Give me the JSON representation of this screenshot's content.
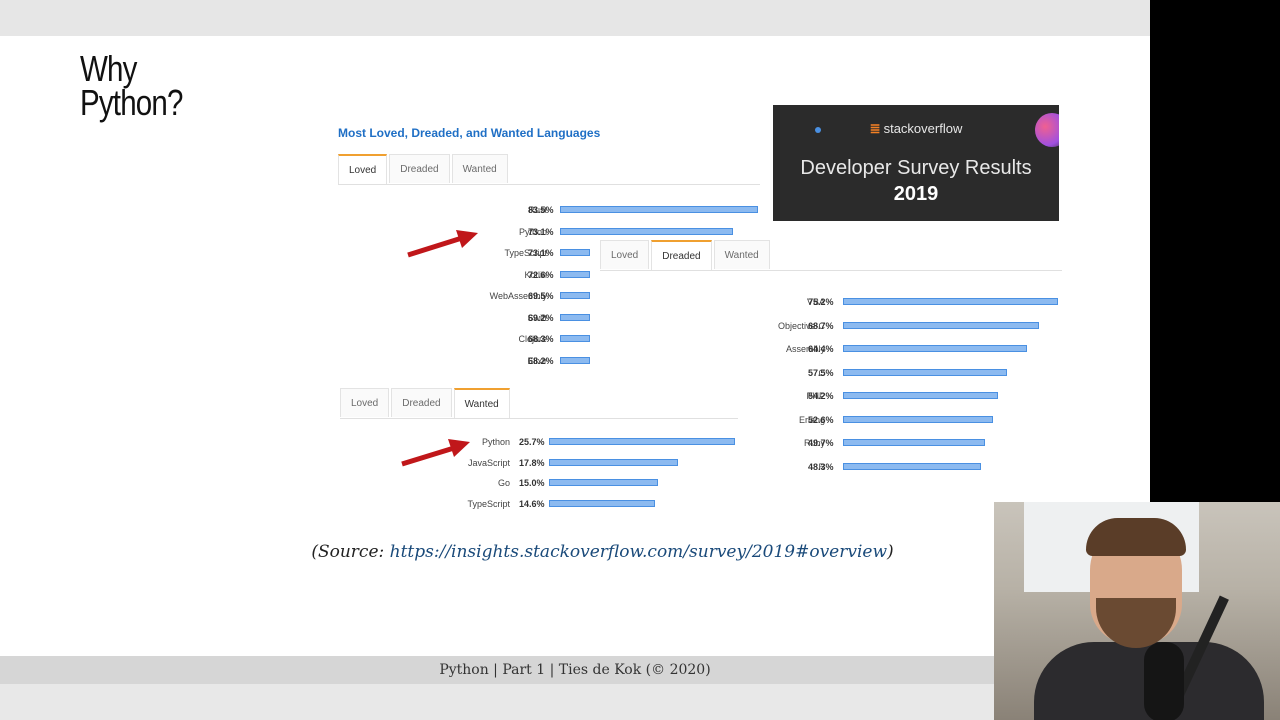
{
  "slide": {
    "title": "Why\nPython?",
    "source_prefix": "(Source: ",
    "source_url": "https://insights.stackoverflow.com/survey/2019#overview",
    "source_suffix": ")",
    "footer": "Python | Part 1 | Ties de Kok (© 2020)"
  },
  "banner": {
    "logo": "stackoverflow",
    "title": "Developer Survey Results",
    "year": "2019"
  },
  "loved_panel": {
    "title": "Most Loved, Dreaded, and Wanted Languages",
    "tabs": [
      "Loved",
      "Dreaded",
      "Wanted"
    ],
    "active_tab": "Loved"
  },
  "dreaded_panel": {
    "tabs": [
      "Loved",
      "Dreaded",
      "Wanted"
    ],
    "active_tab": "Dreaded"
  },
  "wanted_panel": {
    "tabs": [
      "Loved",
      "Dreaded",
      "Wanted"
    ],
    "active_tab": "Wanted"
  },
  "colors": {
    "bar_fill": "#8cbaf0",
    "bar_border": "#4a90e2",
    "accent_tab": "#f0a030",
    "title_blue": "#1f6fc5",
    "arrow_red": "#c0171a"
  },
  "icons": [
    "red-arrow-icon",
    "stack-overflow-logo-icon"
  ],
  "chart_data": [
    {
      "type": "bar",
      "orientation": "horizontal",
      "name": "Loved",
      "categories": [
        "Rust",
        "Python",
        "TypeScript",
        "Kotlin",
        "WebAssembly",
        "Swift",
        "Clojure",
        "Elixir"
      ],
      "values": [
        83.5,
        73.1,
        73.1,
        72.6,
        69.5,
        69.2,
        68.3,
        68.2
      ],
      "labels": [
        "83.5%",
        "73.1%",
        "73.1%",
        "72.6%",
        "69.5%",
        "69.2%",
        "68.3%",
        "68.2%"
      ]
    },
    {
      "type": "bar",
      "orientation": "horizontal",
      "name": "Dreaded",
      "categories": [
        "VBA",
        "Objective-C",
        "Assembly",
        "C",
        "PHP",
        "Erlang",
        "Ruby",
        "R"
      ],
      "values": [
        75.2,
        68.7,
        64.4,
        57.5,
        54.2,
        52.6,
        49.7,
        48.3
      ],
      "labels": [
        "75.2%",
        "68.7%",
        "64.4%",
        "57.5%",
        "54.2%",
        "52.6%",
        "49.7%",
        "48.3%"
      ]
    },
    {
      "type": "bar",
      "orientation": "horizontal",
      "name": "Wanted",
      "categories": [
        "Python",
        "JavaScript",
        "Go",
        "TypeScript"
      ],
      "values": [
        25.7,
        17.8,
        15.0,
        14.6
      ],
      "labels": [
        "25.7%",
        "17.8%",
        "15.0%",
        "14.6%"
      ]
    }
  ]
}
